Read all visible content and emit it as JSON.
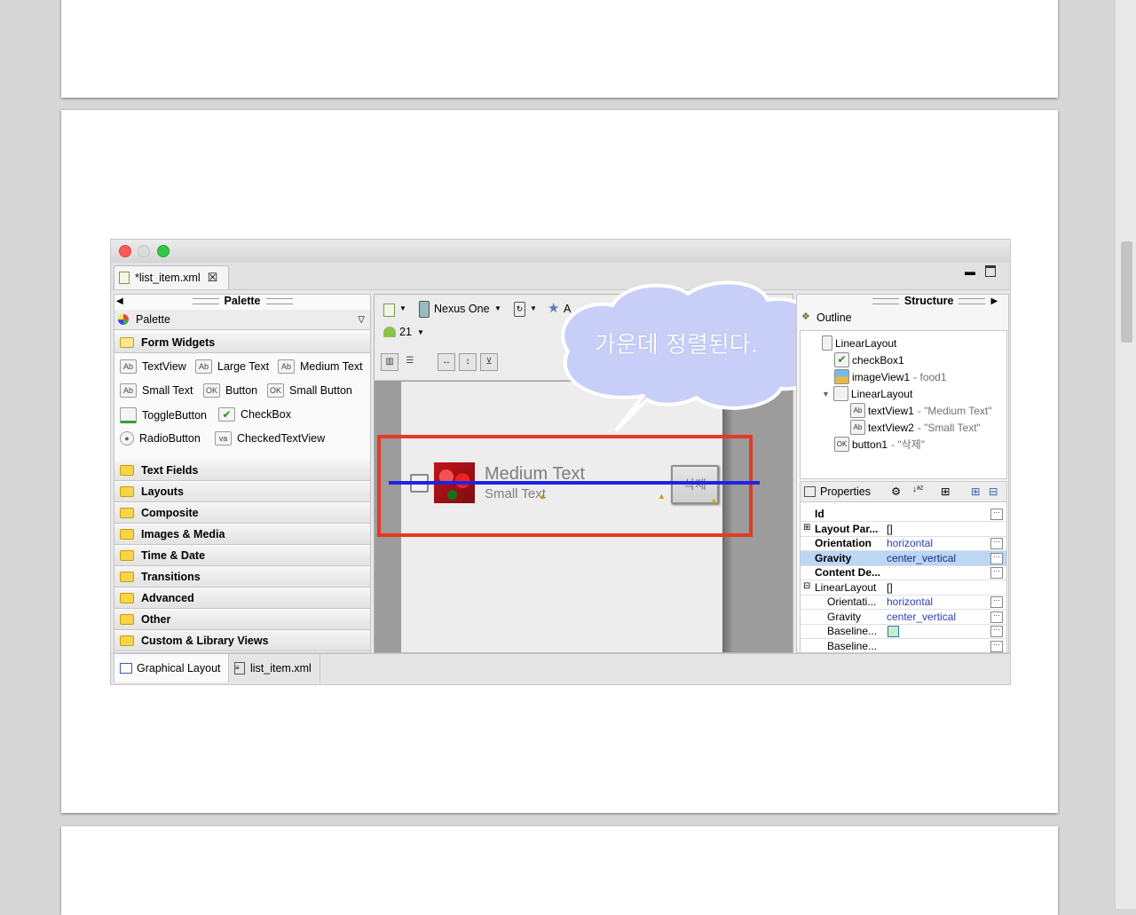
{
  "window": {
    "file_tab": "*list_item.xml",
    "close_tab_icon": "close-icon"
  },
  "palette": {
    "header": "Palette",
    "dropdown_label": "Palette",
    "categories": {
      "form_widgets": "Form Widgets",
      "text_fields": "Text Fields",
      "layouts": "Layouts",
      "composite": "Composite",
      "images_media": "Images & Media",
      "time_date": "Time & Date",
      "transitions": "Transitions",
      "advanced": "Advanced",
      "other": "Other",
      "custom": "Custom & Library Views"
    },
    "widgets": {
      "textview": "TextView",
      "large_text": "Large Text",
      "medium_text": "Medium Text",
      "small_text": "Small Text",
      "button": "Button",
      "small_button": "Small Button",
      "togglebutton": "ToggleButton",
      "checkbox": "CheckBox",
      "radiobutton": "RadioButton",
      "checkedtextview": "CheckedTextView"
    },
    "icon_labels": {
      "ab": "Ab",
      "ok": "OK",
      "va": "va"
    }
  },
  "canvas": {
    "device": "Nexus One",
    "theme_short": "A",
    "api": "21",
    "item": {
      "medium_text": "Medium Text",
      "small_text": "Small Text",
      "button_text": "삭제"
    },
    "callout": "가운데 정렬된다."
  },
  "structure": {
    "header": "Structure",
    "outline_title": "Outline",
    "tree": {
      "root": "LinearLayout",
      "checkbox": "checkBox1",
      "imageview": "imageView1",
      "imageview_src": "- food1",
      "inner_layout": "LinearLayout",
      "textview1": "textView1",
      "textview1_val": "- \"Medium Text\"",
      "textview2": "textView2",
      "textview2_val": "- \"Small Text\"",
      "button": "button1",
      "button_val": "- \"삭제\""
    }
  },
  "properties": {
    "title": "Properties",
    "rows": {
      "id_name": "Id",
      "layout_name": "Layout Par...",
      "layout_val": "[]",
      "orientation_name": "Orientation",
      "orientation_val": "horizontal",
      "gravity_name": "Gravity",
      "gravity_val": "center_vertical",
      "content_name": "Content De...",
      "linearlayout_name": "LinearLayout",
      "linearlayout_val": "[]",
      "orientati_name": "Orientati...",
      "orientati_val": "horizontal",
      "gravity2_name": "Gravity",
      "gravity2_val": "center_vertical",
      "baseline1_name": "Baseline...",
      "baseline2_name": "Baseline..."
    },
    "dots": "···"
  },
  "bottom_tabs": {
    "graphical": "Graphical Layout",
    "xml": "list_item.xml"
  },
  "colors": {
    "highlight_red": "#e53a25",
    "center_line_blue": "#1f22e6",
    "callout_fill": "#c7cff8",
    "selected_row": "#bcd6f5"
  }
}
